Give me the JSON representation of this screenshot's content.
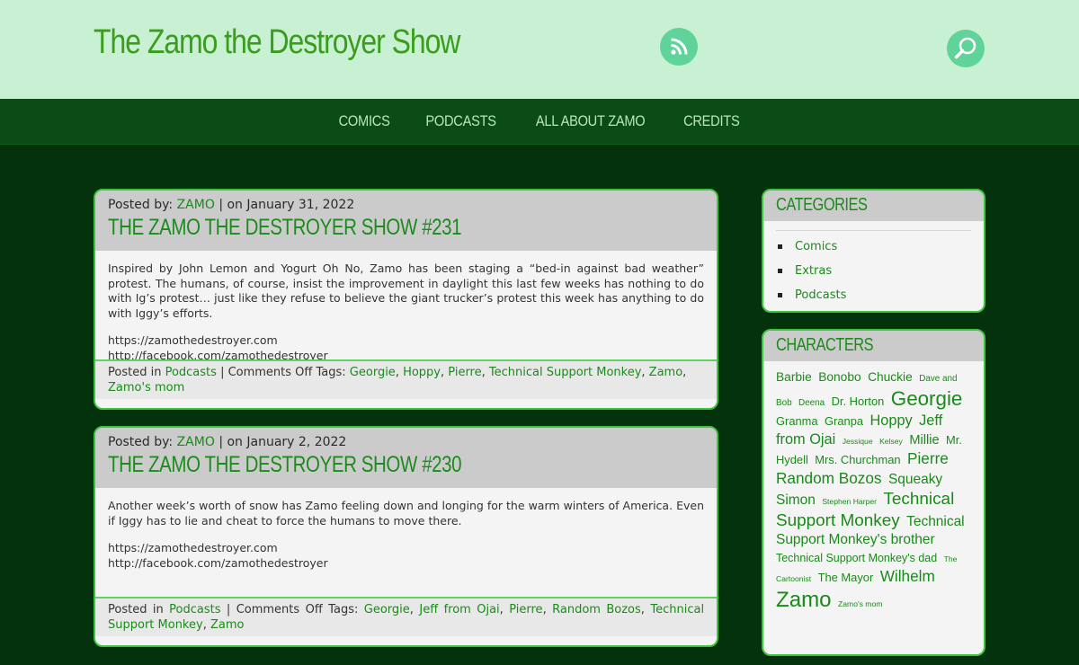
{
  "site": {
    "title": "The Zamo the Destroyer Show"
  },
  "icons": {
    "rss": "rss-icon",
    "search": "search-icon"
  },
  "nav": {
    "items": [
      "COMICS",
      "PODCASTS",
      "ALL ABOUT ZAMO",
      "CREDITS"
    ]
  },
  "posts": [
    {
      "posted_by_label": "Posted by:",
      "author": "ZAMO",
      "date_text": "| on January 31, 2022",
      "title": "THE ZAMO THE DESTROYER SHOW #231",
      "body": "Inspired by John Lemon and Yogurt Oh No, Zamo has been staging a “bed-in against bad weather” protest. The humans, of course, insist the improvement in daylight this last few weeks has nothing to do with Ig’s protest… just like they refuse to believe the giant trucker’s protest this week has anything to do with Iggy’s efforts.",
      "link1": "https://zamothedestroyer.com",
      "link2": "http://facebook.com/zamothedestroyer",
      "posted_in_label": "Posted in",
      "category": "Podcasts",
      "comments_tags_label": "| Comments Off Tags:",
      "tags": [
        "Georgie",
        "Hoppy",
        "Pierre",
        "Technical Support Monkey",
        "Zamo",
        "Zamo's mom"
      ]
    },
    {
      "posted_by_label": "Posted by:",
      "author": "ZAMO",
      "date_text": "| on January 2, 2022",
      "title": "THE ZAMO THE DESTROYER SHOW #230",
      "body": "Another week’s worth of snow has Zamo feeling down and longing for the warm winters of America. Even if Iggy has to lie and cheat to force the humans to move there.",
      "link1": "https://zamothedestroyer.com",
      "link2": "http://facebook.com/zamothedestroyer",
      "posted_in_label": "Posted in",
      "category": "Podcasts",
      "comments_tags_label": "| Comments Off Tags:",
      "tags": [
        "Georgie",
        "Jeff from Ojai",
        "Pierre",
        "Random Bozos",
        "Technical Support Monkey",
        "Zamo"
      ]
    }
  ],
  "sidebar": {
    "categories": {
      "title": "CATEGORIES",
      "items": [
        "Comics",
        "Extras",
        "Podcasts"
      ]
    },
    "characters": {
      "title": "CHARACTERS",
      "tags": [
        {
          "label": "Barbie",
          "size": 16
        },
        {
          "label": "Bonobo",
          "size": 16
        },
        {
          "label": "Chuckie",
          "size": 16
        },
        {
          "label": "Dave and Bob",
          "size": 11.5
        },
        {
          "label": "Deena",
          "size": 11.5
        },
        {
          "label": "Dr. Horton",
          "size": 15
        },
        {
          "label": "Georgie",
          "size": 26
        },
        {
          "label": "Granma",
          "size": 15
        },
        {
          "label": "Granpa",
          "size": 15
        },
        {
          "label": "Hoppy",
          "size": 19
        },
        {
          "label": "Jeff from Ojai",
          "size": 19
        },
        {
          "label": "Jessique",
          "size": 10
        },
        {
          "label": "Kelsey",
          "size": 10
        },
        {
          "label": "Millie",
          "size": 17
        },
        {
          "label": "Mr. Hydell",
          "size": 15
        },
        {
          "label": "Mrs. Churchman",
          "size": 15
        },
        {
          "label": "Pierre",
          "size": 20
        },
        {
          "label": "Random Bozos",
          "size": 20
        },
        {
          "label": "Squeaky Simon",
          "size": 18
        },
        {
          "label": "Stephen Harper",
          "size": 10
        },
        {
          "label": "Technical Support Monkey",
          "size": 22
        },
        {
          "label": "Technical Support Monkey's brother",
          "size": 18
        },
        {
          "label": "Technical Support Monkey's dad",
          "size": 14.5
        },
        {
          "label": "The Cartoonist",
          "size": 10
        },
        {
          "label": "The Mayor",
          "size": 15
        },
        {
          "label": "Wilhelm",
          "size": 20
        },
        {
          "label": "Zamo",
          "size": 28
        },
        {
          "label": "Zamo's mom",
          "size": 10
        }
      ]
    }
  }
}
